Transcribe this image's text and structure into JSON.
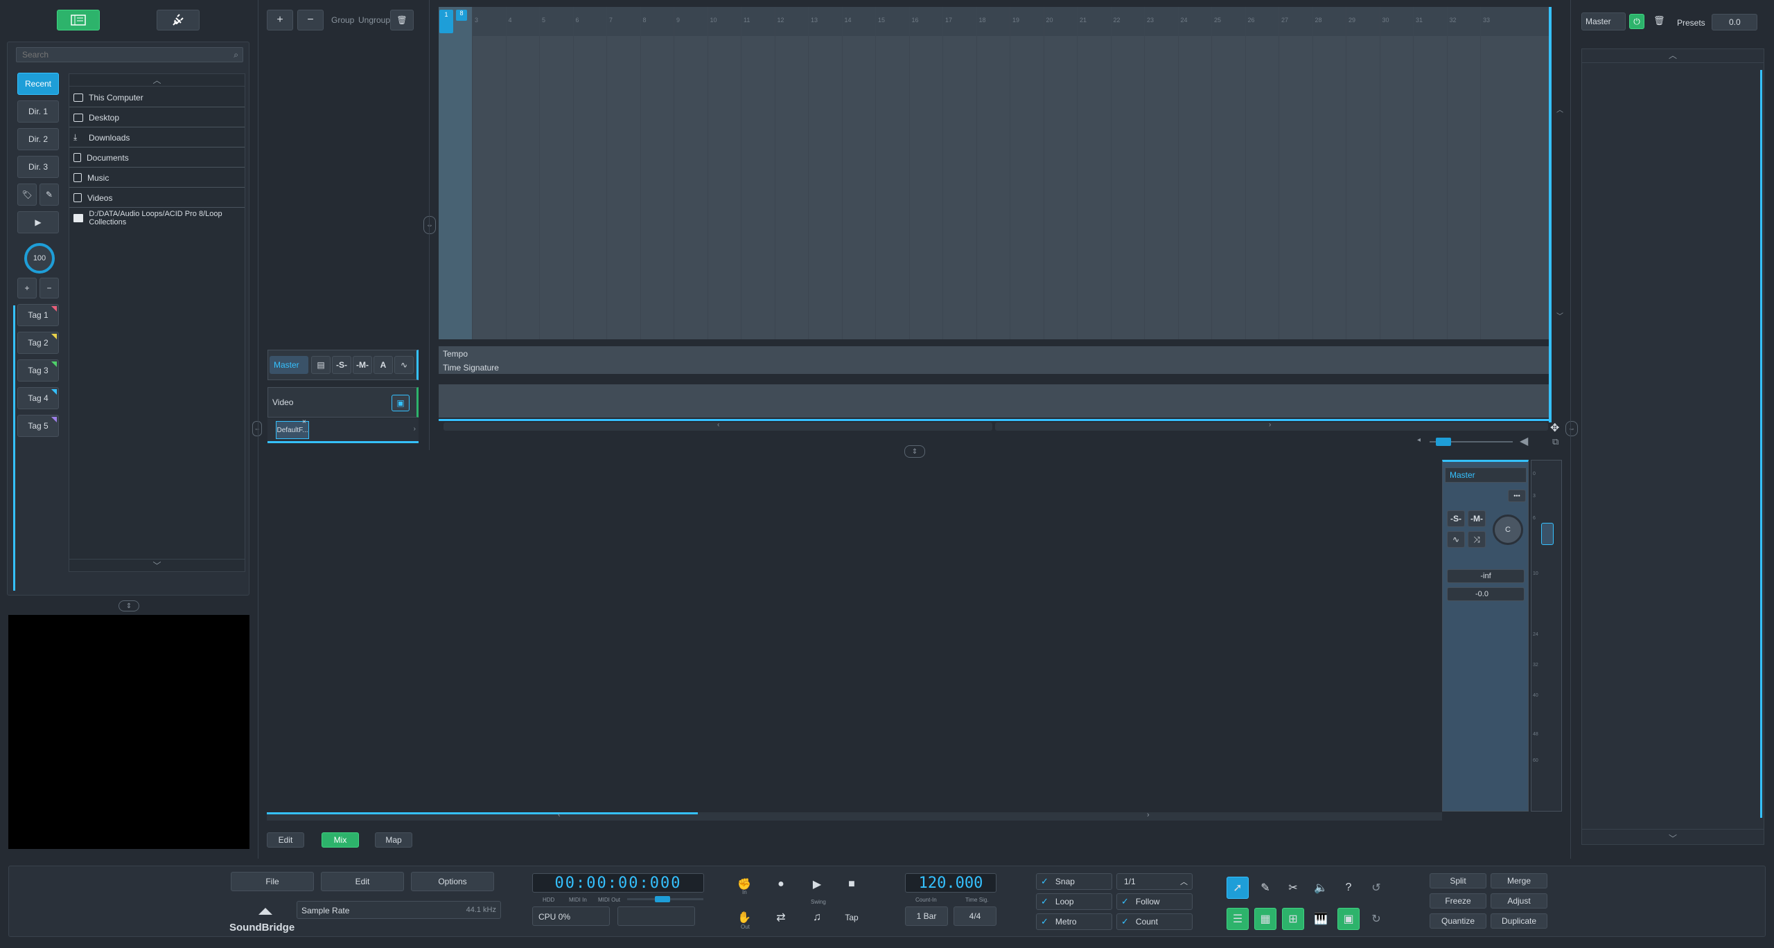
{
  "top_buttons": {
    "browser_icon": "browser-icon",
    "plugin_icon": "plug-icon"
  },
  "browser": {
    "search_placeholder": "Search",
    "dirs": [
      "Recent",
      "Dir. 1",
      "Dir. 2",
      "Dir. 3"
    ],
    "zoom": "100",
    "tags": [
      {
        "label": "Tag 1",
        "color": "#e85f7a"
      },
      {
        "label": "Tag 2",
        "color": "#e8d14a"
      },
      {
        "label": "Tag 3",
        "color": "#4fd16a"
      },
      {
        "label": "Tag 4",
        "color": "#35c1ff"
      },
      {
        "label": "Tag 5",
        "color": "#9d7fe8"
      }
    ],
    "files": [
      {
        "label": "This Computer",
        "icon": "computer-icon"
      },
      {
        "label": "Desktop",
        "icon": "desktop-icon"
      },
      {
        "label": "Downloads",
        "icon": "download-icon"
      },
      {
        "label": "Documents",
        "icon": "document-icon"
      },
      {
        "label": "Music",
        "icon": "music-icon"
      },
      {
        "label": "Videos",
        "icon": "video-icon"
      },
      {
        "label": "D:/DATA/Audio Loops/ACID Pro 8/Loop Collections",
        "icon": "folder-icon"
      }
    ]
  },
  "track_toolbar": {
    "group": "Group",
    "ungroup": "Ungroup"
  },
  "tracks": {
    "master_label": "Master",
    "solo": "-S-",
    "mute": "-M-",
    "automation": "A",
    "video_label": "Video",
    "video_clip": "DefaultF..."
  },
  "ruler": {
    "markers": [
      "1",
      "8"
    ],
    "bars": [
      "3",
      "4",
      "5",
      "6",
      "7",
      "8",
      "9",
      "10",
      "11",
      "12",
      "13",
      "14",
      "15",
      "16",
      "17",
      "18",
      "19",
      "20",
      "21",
      "22",
      "23",
      "24",
      "25",
      "26",
      "27",
      "28",
      "29",
      "30",
      "31",
      "32",
      "33"
    ]
  },
  "global_tracks": {
    "tempo": "Tempo",
    "time_signature": "Time Signature"
  },
  "right_panel": {
    "title": "Master",
    "presets": "Presets",
    "value": "0.0"
  },
  "mixer": {
    "master": "Master",
    "solo": "-S-",
    "mute": "-M-",
    "pan": "C",
    "peak": "-inf",
    "volume": "-0.0",
    "scale": [
      "0",
      "3",
      "6",
      "10",
      "24",
      "32",
      "40",
      "48",
      "60"
    ]
  },
  "view_tabs": [
    "Edit",
    "Mix",
    "Map"
  ],
  "transport": {
    "menu": [
      "File",
      "Edit",
      "Options"
    ],
    "brand": "SoundBridge",
    "sample_rate_label": "Sample Rate",
    "sample_rate_value": "44.1 kHz",
    "time": "00:00:00:000",
    "hdd": "HDD",
    "midi_in": "MIDI In",
    "midi_out": "MIDI Out",
    "cpu": "CPU 0%",
    "in_label": "In",
    "out_label": "Out",
    "swing": "Swing",
    "tap": "Tap",
    "tempo": "120.000",
    "count_in_label": "Count-In",
    "count_in": "1 Bar",
    "time_sig_label": "Time Sig.",
    "time_sig": "4/4",
    "snap": "Snap",
    "loop": "Loop",
    "metro": "Metro",
    "grid": "1/1",
    "follow": "Follow",
    "count": "Count",
    "right_buttons": [
      "Split",
      "Merge",
      "Freeze",
      "Adjust",
      "Quantize",
      "Duplicate"
    ]
  }
}
